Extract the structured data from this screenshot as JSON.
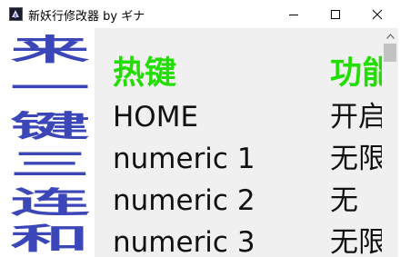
{
  "window": {
    "title": "新妖行修改器 by ギナ",
    "icon": "app-icon"
  },
  "banner": {
    "lines": [
      "来",
      "一",
      "键",
      "三",
      "连",
      "和"
    ],
    "color": "#3b46b8"
  },
  "table": {
    "headers": {
      "hotkey": "热键",
      "function": "功能"
    },
    "header_color": "#22dd00",
    "rows": [
      {
        "key": "HOME",
        "func": "开启"
      },
      {
        "key": "numeric 1",
        "func": "无限"
      },
      {
        "key": "numeric 2",
        "func": "无"
      },
      {
        "key": "numeric 3",
        "func": "无限"
      }
    ]
  }
}
